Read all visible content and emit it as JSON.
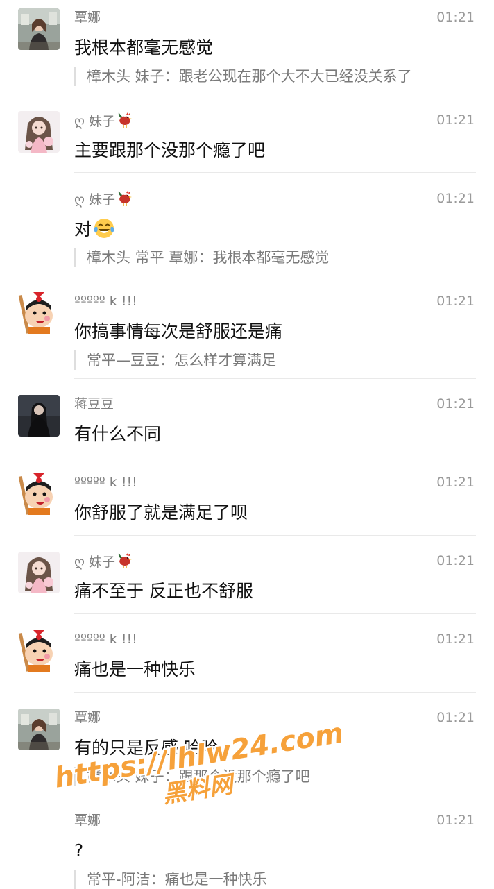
{
  "messages": [
    {
      "sender": "覃娜",
      "time": "01:21",
      "text": "我根本都毫无感觉",
      "quote": "樟木头 妹子：跟老公现在那个大不大已经没关系了",
      "avatar_icon": "woman-photo-avatar"
    },
    {
      "sender": "ღ 妹子",
      "sender_emoji": "rooster-emoji",
      "time": "01:21",
      "text": "主要跟那个没那个瘾了吧",
      "avatar_icon": "anime-girl-avatar"
    },
    {
      "sender": "ღ 妹子",
      "sender_emoji": "rooster-emoji",
      "time": "01:21",
      "text": "对",
      "text_emoji": "crying-laughing-emoji",
      "quote": "樟木头 常平 覃娜：我根本都毫无感觉"
    },
    {
      "sender": "ººººº k !!!",
      "time": "01:21",
      "text": "你搞事情每次是舒服还是痛",
      "quote": "常平—豆豆：怎么样才算满足",
      "avatar_icon": "crayon-shinchan-avatar"
    },
    {
      "sender": "蒋豆豆",
      "time": "01:21",
      "text": "有什么不同",
      "avatar_icon": "dark-photo-avatar"
    },
    {
      "sender": "ººººº k !!!",
      "time": "01:21",
      "text": "你舒服了就是满足了呗",
      "avatar_icon": "crayon-shinchan-avatar"
    },
    {
      "sender": "ღ 妹子",
      "sender_emoji": "rooster-emoji",
      "time": "01:21",
      "text": "痛不至于 反正也不舒服",
      "avatar_icon": "anime-girl-avatar"
    },
    {
      "sender": "ººººº k !!!",
      "time": "01:21",
      "text": "痛也是一种快乐",
      "avatar_icon": "crayon-shinchan-avatar"
    },
    {
      "sender": "覃娜",
      "time": "01:21",
      "text": "有的只是反感 哈哈",
      "quote": "樟木头 妹子：跟那个没那个瘾了吧",
      "avatar_icon": "woman-photo-avatar"
    },
    {
      "sender": "覃娜",
      "time": "01:21",
      "text": "?",
      "quote": "常平-阿洁：痛也是一种快乐"
    }
  ],
  "watermark": {
    "url": "https://lhlw24.com",
    "subtitle": "黑料网"
  },
  "colors": {
    "watermark": "#f6a13a",
    "text": "#111111",
    "meta": "#808080"
  }
}
